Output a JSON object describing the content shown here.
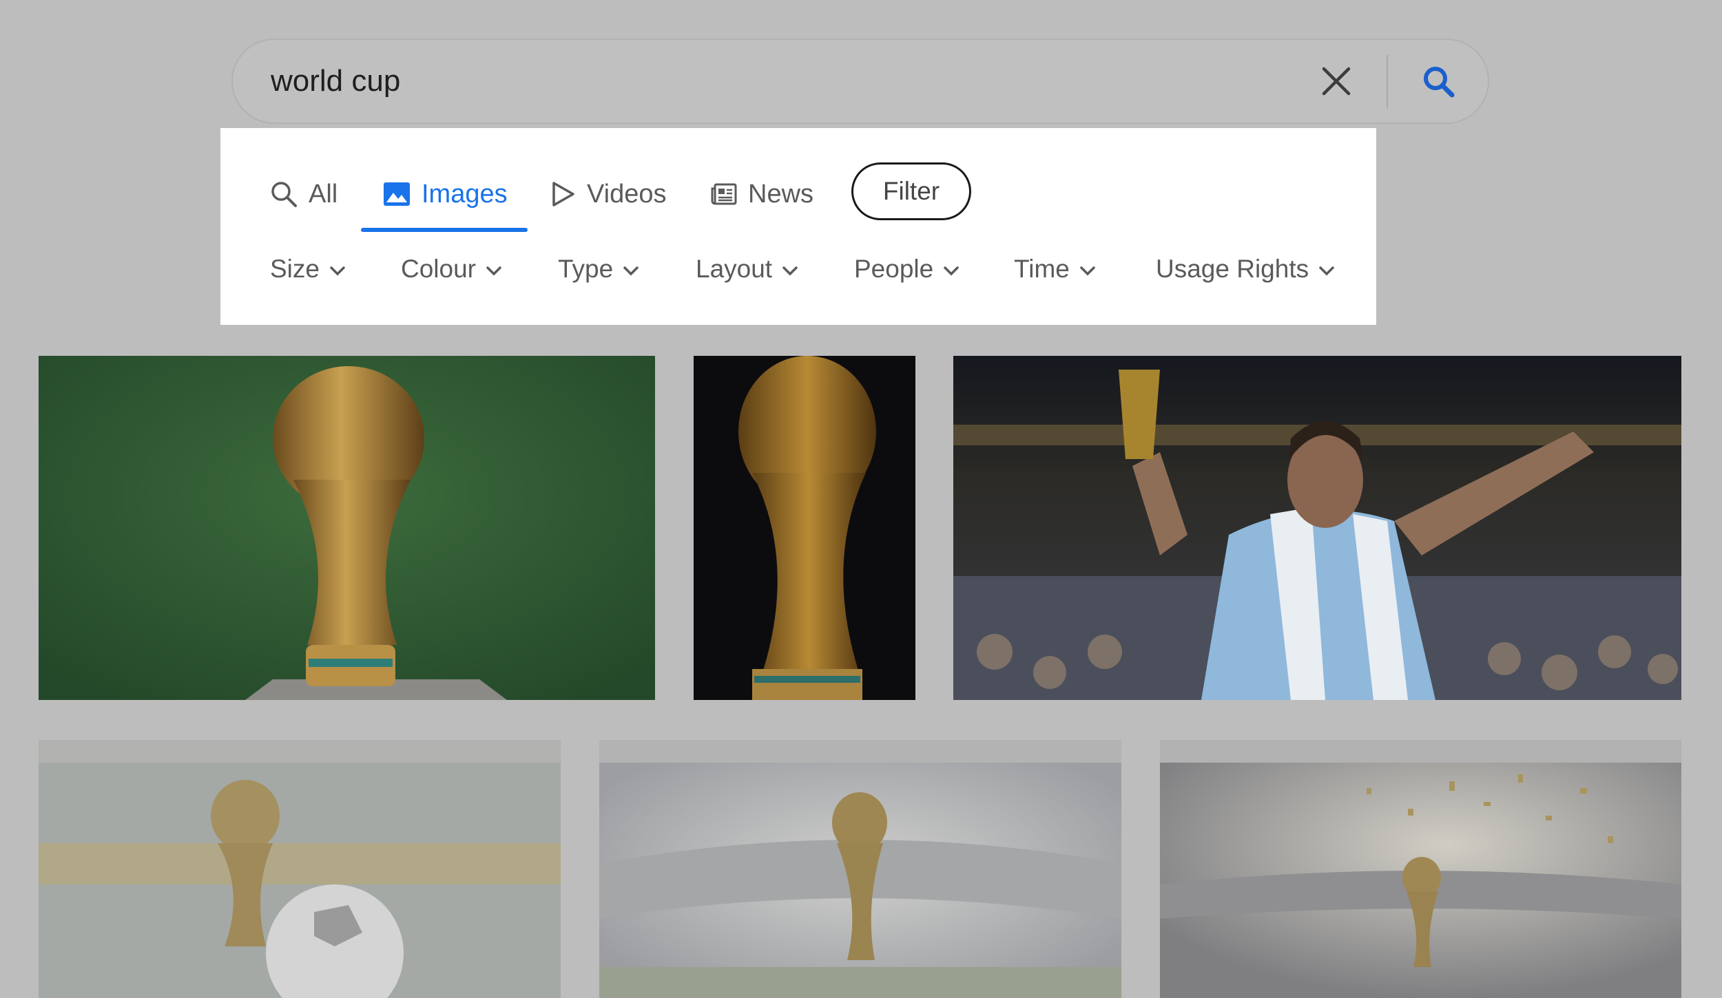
{
  "search": {
    "query": "world cup",
    "clear_icon": "close-icon",
    "submit_icon": "search-icon"
  },
  "tabs": [
    {
      "label": "All",
      "icon": "search-icon",
      "active": false
    },
    {
      "label": "Images",
      "icon": "image-icon",
      "active": true
    },
    {
      "label": "Videos",
      "icon": "play-icon",
      "active": false
    },
    {
      "label": "News",
      "icon": "news-icon",
      "active": false
    }
  ],
  "filter_button": "Filter",
  "dropdowns": [
    {
      "label": "Size"
    },
    {
      "label": "Colour"
    },
    {
      "label": "Type"
    },
    {
      "label": "Layout"
    },
    {
      "label": "People"
    },
    {
      "label": "Time"
    },
    {
      "label": "Usage Rights"
    }
  ],
  "results": [
    {
      "subject": "trophy-on-green-background"
    },
    {
      "subject": "trophy-on-black-background"
    },
    {
      "subject": "player-celebrating-with-trophy"
    },
    {
      "subject": "trophy-and-ball-in-stadium"
    },
    {
      "subject": "trophy-in-stadium-with-confetti"
    },
    {
      "subject": "trophy-in-stadium-with-gold-confetti"
    }
  ],
  "colors": {
    "accent": "#1a73e8",
    "overlay": "#bdbdbd",
    "panel": "#ffffff"
  }
}
